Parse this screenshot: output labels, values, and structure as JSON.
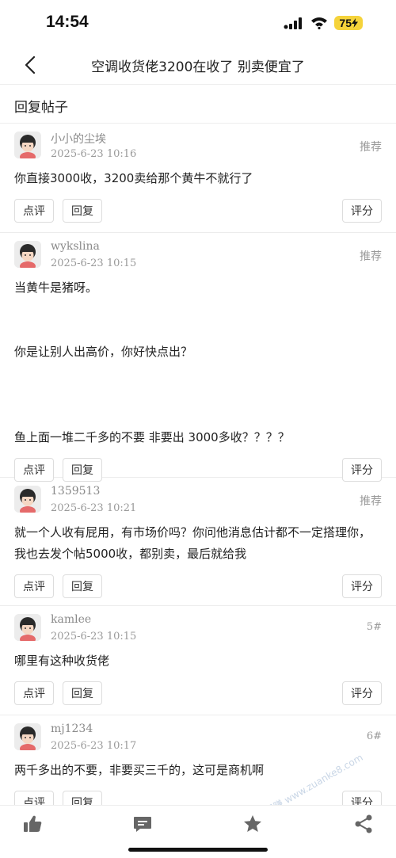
{
  "status": {
    "time": "14:54",
    "battery": "75"
  },
  "nav": {
    "title": "空调收货佬3200在收了 别卖便宜了"
  },
  "section": {
    "title": "回复帖子"
  },
  "labels": {
    "review": "点评",
    "reply": "回复",
    "rate": "评分"
  },
  "posts": [
    {
      "user": "小小的尘埃",
      "time": "2025-6-23 10:16",
      "tag": "推荐",
      "content": [
        "你直接3000收，3200卖给那个黄牛不就行了"
      ]
    },
    {
      "user": "wykslina",
      "time": "2025-6-23 10:15",
      "tag": "推荐",
      "content": [
        "当黄牛是猪呀。",
        "你是让别人出高价，你好快点出？",
        "鱼上面一堆二千多的不要   非要出  3000多收？？？？"
      ]
    },
    {
      "user": "1359513",
      "time": "2025-6-23 10:21",
      "tag": "推荐",
      "content": [
        "就一个人收有屁用，有市场价吗？你问他消息估计都不一定搭理你，我也去发个帖5000收，都别卖，最后就给我"
      ]
    },
    {
      "user": "kamlee",
      "time": "2025-6-23 10:15",
      "tag": "5#",
      "content": [
        "哪里有这种收货佬"
      ]
    },
    {
      "user": "mj1234",
      "time": "2025-6-23 10:17",
      "tag": "6#",
      "content": [
        "两千多出的不要，非要买三千的，这可是商机啊"
      ]
    }
  ],
  "watermark": "赚客吧，有奖一起赚 www.zuanke8.com",
  "icons": [
    "back-arrow-icon",
    "thumb-up-icon",
    "comment-icon",
    "star-icon",
    "share-icon"
  ]
}
